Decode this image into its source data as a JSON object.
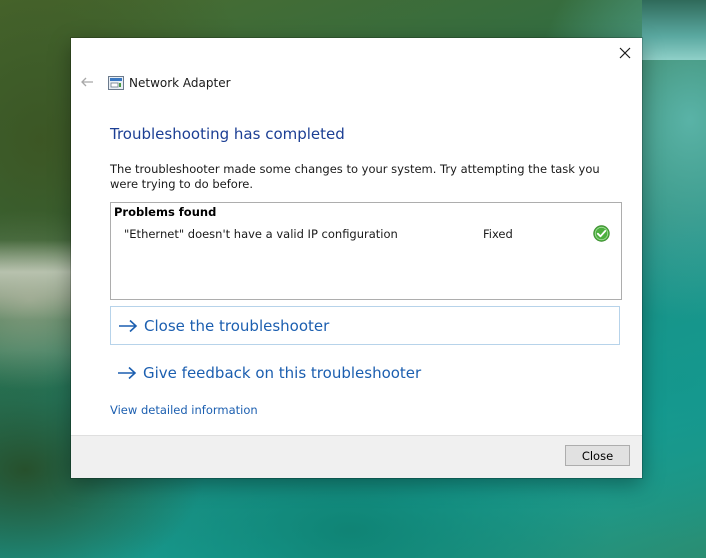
{
  "window": {
    "title": "Network Adapter",
    "close_icon": "close-icon",
    "back_icon": "back-arrow-icon",
    "app_icon": "network-adapter-icon"
  },
  "main": {
    "heading": "Troubleshooting has completed",
    "description": "The troubleshooter made some changes to your system. Try attempting the task you were trying to do before."
  },
  "problems": {
    "header": "Problems found",
    "items": [
      {
        "text": "\"Ethernet\" doesn't have a valid IP configuration",
        "status": "Fixed",
        "status_icon": "green-check-icon"
      }
    ]
  },
  "actions": {
    "close_troubleshooter": "Close the troubleshooter",
    "give_feedback": "Give feedback on this troubleshooter",
    "view_details": "View detailed information"
  },
  "footer": {
    "close_label": "Close"
  },
  "colors": {
    "heading": "#1c3f94",
    "link": "#1c5fb0",
    "check": "#4caf3e",
    "focus_border": "#b7d3ea"
  }
}
